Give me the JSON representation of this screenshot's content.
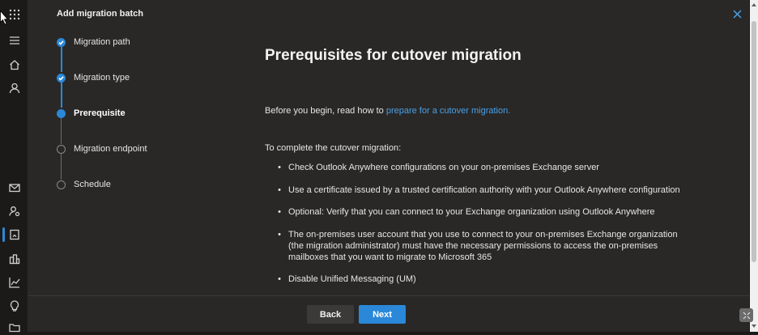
{
  "panel": {
    "title": "Add migration batch",
    "close_icon": "close-icon"
  },
  "rail": {
    "icons": [
      "app-launcher-icon",
      "hamburger-menu-icon",
      "home-icon",
      "user-icon",
      "mail-icon",
      "user-settings-icon",
      "reports-icon",
      "org-icon",
      "analytics-icon",
      "lightbulb-icon",
      "folder-icon"
    ]
  },
  "steps": [
    {
      "label": "Migration path",
      "state": "done"
    },
    {
      "label": "Migration type",
      "state": "done"
    },
    {
      "label": "Prerequisite",
      "state": "current"
    },
    {
      "label": "Migration endpoint",
      "state": "todo"
    },
    {
      "label": "Schedule",
      "state": "todo"
    }
  ],
  "content": {
    "heading": "Prerequisites for cutover migration",
    "intro_prefix": "Before you begin, read how to ",
    "intro_link": "prepare for a cutover migration.",
    "list_intro": "To complete the cutover migration:",
    "bullets": [
      "Check Outlook Anywhere configurations on your on-premises Exchange server",
      "Use a certificate issued by a trusted certification authority with your Outlook Anywhere configuration",
      "Optional: Verify that you can connect to your Exchange organization using Outlook Anywhere",
      "The on-premises user account that you use to connect to your on-premises Exchange organization (the migration administrator) must have the necessary permissions to access the on-premises mailboxes that you want to migrate to Microsoft 365",
      "Disable Unified Messaging (UM)"
    ]
  },
  "footer": {
    "back_label": "Back",
    "next_label": "Next"
  },
  "colors": {
    "accent": "#2b88d8",
    "link": "#4aa0e6",
    "panel_bg": "#292827",
    "rail_bg": "#1b1a19"
  }
}
